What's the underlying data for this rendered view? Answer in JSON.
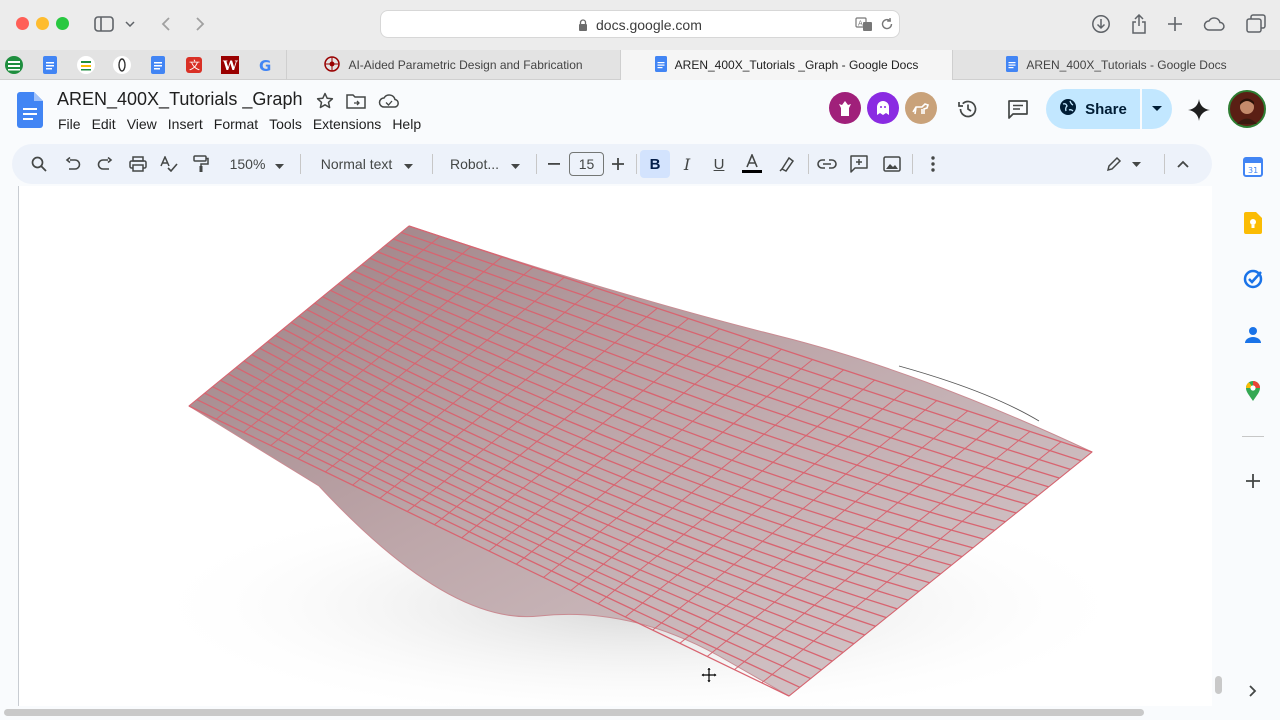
{
  "browser": {
    "url": "docs.google.com",
    "tabs": [
      {
        "label": "AI-Aided Parametric Design and Fabrication",
        "active": false
      },
      {
        "label": "AREN_400X_Tutorials _Graph - Google Docs",
        "active": true
      },
      {
        "label": "AREN_400X_Tutorials - Google Docs",
        "active": false
      }
    ],
    "pinned_icons": [
      "sheets-icon",
      "docs-icon",
      "slides-icon",
      "claude-icon",
      "docs-icon",
      "translate-icon",
      "w-icon",
      "google-icon"
    ]
  },
  "doc": {
    "title": "AREN_400X_Tutorials _Graph",
    "menu": [
      "File",
      "Edit",
      "View",
      "Insert",
      "Format",
      "Tools",
      "Extensions",
      "Help"
    ],
    "share_label": "Share"
  },
  "toolbar": {
    "zoom": "150%",
    "style": "Normal text",
    "font": "Robot...",
    "font_size": "15"
  },
  "colors": {
    "docs_blue": "#4285f4",
    "share_bg": "#c2e7ff",
    "toolbar_bg": "#edf2fa",
    "fin_edge": "#d86470",
    "avatar_1": "#a0207a",
    "avatar_2": "#8a2be2",
    "avatar_3": "#c9a27a"
  }
}
